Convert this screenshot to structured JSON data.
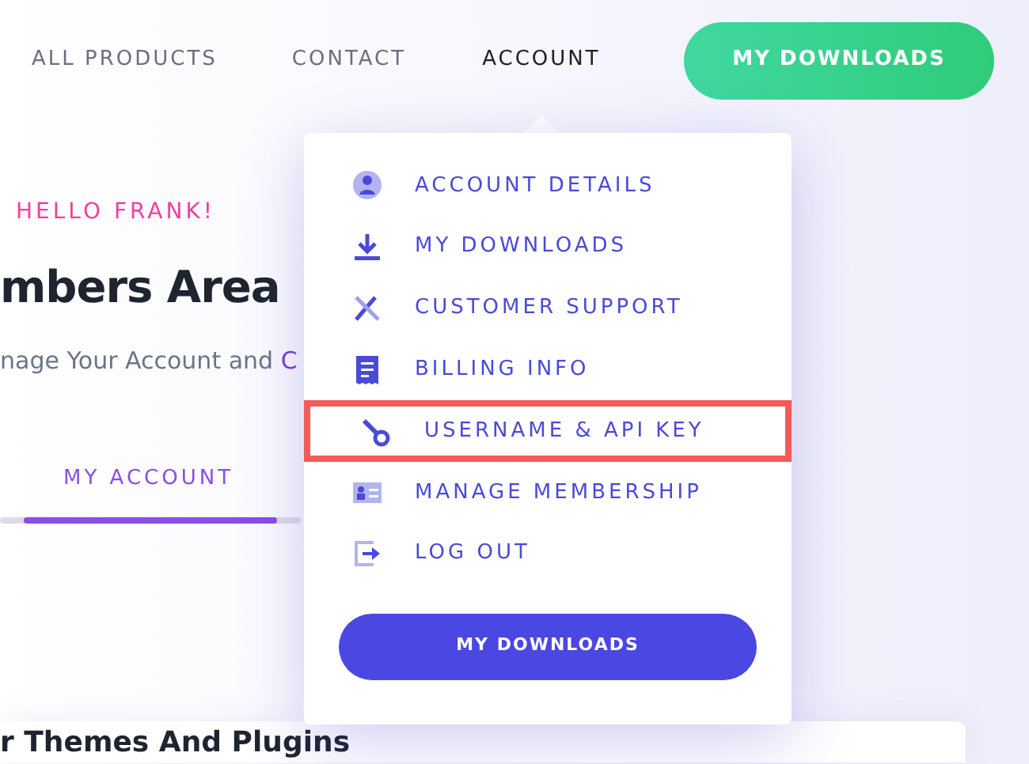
{
  "nav": {
    "links": [
      {
        "label": "ALL PRODUCTS",
        "selected": false
      },
      {
        "label": "CONTACT",
        "selected": false
      },
      {
        "label": "ACCOUNT",
        "selected": true
      }
    ],
    "cta": "MY DOWNLOADS"
  },
  "hero": {
    "greeting": "HELLO FRANK!",
    "heading": "mbers Area",
    "subtitle": "nage Your Account and ",
    "subtitle_link": "C"
  },
  "tabs": [
    {
      "label": "MY ACCOUNT",
      "selected": true
    }
  ],
  "card": {
    "heading": "r Themes And Plugins"
  },
  "dropdown": {
    "items": [
      {
        "label": "ACCOUNT DETAILS",
        "highlighted": false
      },
      {
        "label": "MY DOWNLOADS",
        "highlighted": false
      },
      {
        "label": "CUSTOMER SUPPORT",
        "highlighted": false
      },
      {
        "label": "BILLING INFO",
        "highlighted": false
      },
      {
        "label": "USERNAME & API KEY",
        "highlighted": true
      },
      {
        "label": "MANAGE MEMBERSHIP",
        "highlighted": false
      },
      {
        "label": "LOG OUT",
        "highlighted": false
      }
    ],
    "button": "MY DOWNLOADS"
  }
}
